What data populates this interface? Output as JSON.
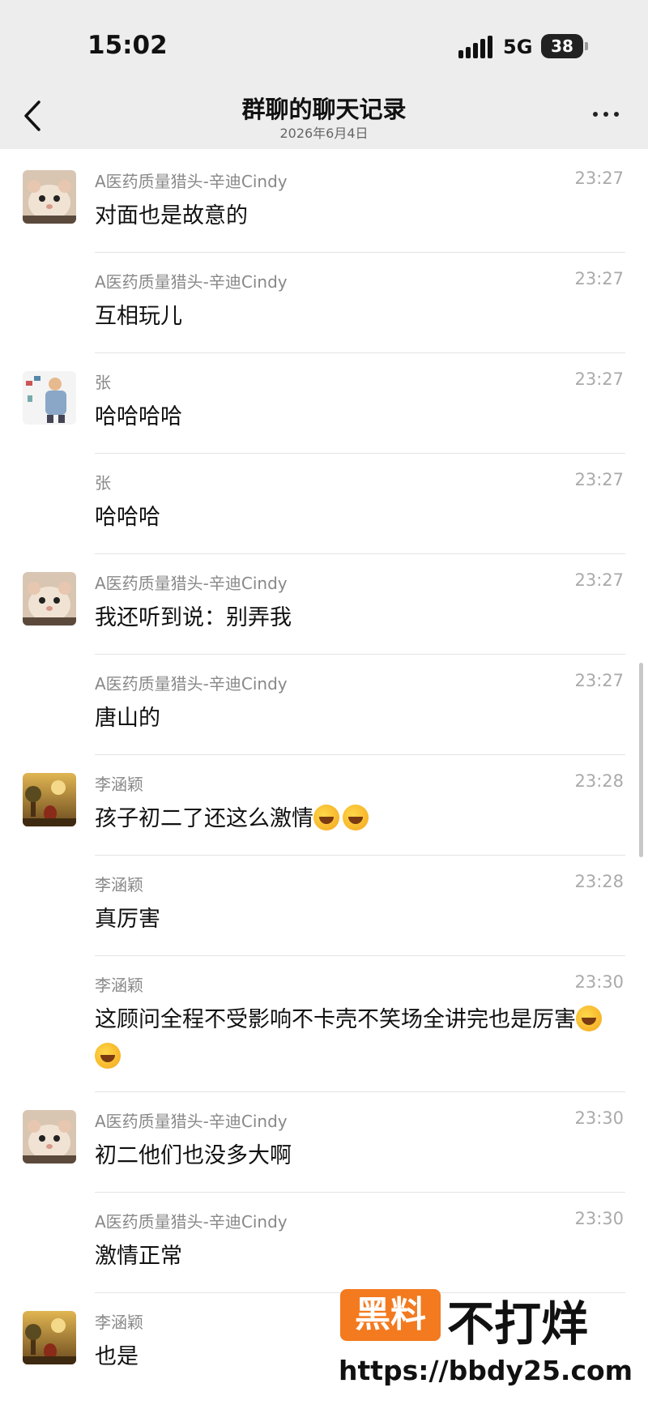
{
  "status_bar": {
    "time": "15:02",
    "network": "5G",
    "battery": "38"
  },
  "header": {
    "title": "群聊的聊天记录",
    "subtitle": "2026年6月4日"
  },
  "messages": [
    {
      "sender": "A医药质量猎头-辛迪Cindy",
      "time": "23:27",
      "text": "对面也是故意的",
      "avatar": "hamster",
      "emoji_count": 0
    },
    {
      "sender": "A医药质量猎头-辛迪Cindy",
      "time": "23:27",
      "text": "互相玩儿",
      "avatar": "",
      "emoji_count": 0
    },
    {
      "sender": "张",
      "time": "23:27",
      "text": "哈哈哈哈",
      "avatar": "boy",
      "emoji_count": 0
    },
    {
      "sender": "张",
      "time": "23:27",
      "text": "哈哈哈",
      "avatar": "",
      "emoji_count": 0
    },
    {
      "sender": "A医药质量猎头-辛迪Cindy",
      "time": "23:27",
      "text": "我还听到说：别弄我",
      "avatar": "hamster",
      "emoji_count": 0
    },
    {
      "sender": "A医药质量猎头-辛迪Cindy",
      "time": "23:27",
      "text": "唐山的",
      "avatar": "",
      "emoji_count": 0
    },
    {
      "sender": "李涵颖",
      "time": "23:28",
      "text": "孩子初二了还这么激情",
      "avatar": "painting",
      "emoji_count": 2
    },
    {
      "sender": "李涵颖",
      "time": "23:28",
      "text": "真厉害",
      "avatar": "",
      "emoji_count": 0
    },
    {
      "sender": "李涵颖",
      "time": "23:30",
      "text": "这顾问全程不受影响不卡壳不笑场全讲完也是厉害",
      "avatar": "",
      "emoji_count": 2
    },
    {
      "sender": "A医药质量猎头-辛迪Cindy",
      "time": "23:30",
      "text": "初二他们也没多大啊",
      "avatar": "hamster",
      "emoji_count": 0
    },
    {
      "sender": "A医药质量猎头-辛迪Cindy",
      "time": "23:30",
      "text": "激情正常",
      "avatar": "",
      "emoji_count": 0
    },
    {
      "sender": "李涵颖",
      "time": "",
      "text": "也是",
      "avatar": "painting",
      "emoji_count": 0
    }
  ],
  "watermark": {
    "badge": "黑料",
    "text": "不打烊",
    "url": "https://bbdy25.com"
  },
  "colors": {
    "header_bg": "#ededed",
    "watermark_orange": "#f37a1f"
  }
}
